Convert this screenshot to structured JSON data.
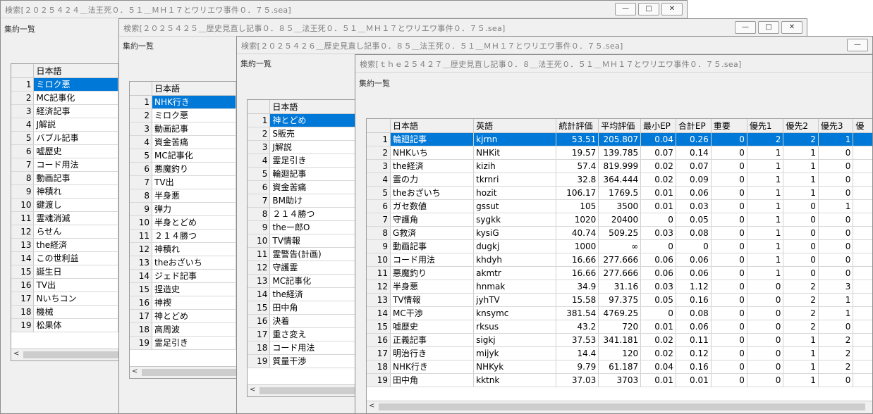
{
  "windows": [
    {
      "title": "検索[２０２５４２４＿法王死０．５１＿ＭＨ１７とワリエワ事件０．７５.sea]",
      "subtitle": "集約一覧",
      "header": "日本語",
      "rows": [
        "ミロク悪",
        "MC記事化",
        "経済記事",
        "J解説",
        "バブル記事",
        "嘘歴史",
        "コード用法",
        "動画記事",
        "神積れ",
        "鍵渡し",
        "霊魂消滅",
        "らせん",
        "the経済",
        "この世利益",
        "誕生日",
        "TV出",
        "Nいちコン",
        "機械",
        "松果体"
      ],
      "selected": 0
    },
    {
      "title": "検索[２０２５４２５＿歴史見直し記事０．８５＿法王死０．５１＿ＭＨ１７とワリエワ事件０．７５.sea]",
      "subtitle": "集約一覧",
      "header": "日本語",
      "rows": [
        "NHK行き",
        "ミロク悪",
        "動画記事",
        "資金苦痛",
        "MC記事化",
        "悪魔釣り",
        "TV出",
        "半身悪",
        "弾力",
        "半身とどめ",
        "２１４勝つ",
        "神積れ",
        "theおざいち",
        "ジェド記事",
        "捏造史",
        "神褉",
        "神とどめ",
        "高周波",
        "霊足引き"
      ],
      "selected": 0
    },
    {
      "title": "検索[２０２５４２６＿歴史見直し記事０．８５＿法王死０．５１＿ＭＨ１７とワリエワ事件０．７５.sea]",
      "subtitle": "集約一覧",
      "header": "日本語",
      "rows": [
        "神とどめ",
        "S販売",
        "J解説",
        "霊足引き",
        "輪廻記事",
        "資金苦痛",
        "BM助け",
        "２１４勝つ",
        "theー郎O",
        "TV情報",
        "霊警告(計画)",
        "守護霊",
        "MC記事化",
        "the経済",
        "田中角",
        "決着",
        "重さ変え",
        "コード用法",
        "質量干渉"
      ],
      "selected": 0
    }
  ],
  "main_window": {
    "title": "検索[ｔｈｅ２５４２７＿歴史見直し記事０．８＿法王死０．５１＿ＭＨ１７とワリエワ事件０．７５.sea]",
    "subtitle": "集約一覧",
    "columns": [
      "日本語",
      "英語",
      "統計評価",
      "平均評価",
      "最小EP",
      "合計EP",
      "重要",
      "優先1",
      "優先2",
      "優先3",
      "優"
    ],
    "rows": [
      [
        "輪廻記事",
        "kjrnn",
        "53.51",
        "205.807",
        "0.04",
        "0.26",
        "0",
        "2",
        "2",
        "1"
      ],
      [
        "NHKいち",
        "NHKit",
        "19.57",
        "139.785",
        "0.07",
        "0.14",
        "0",
        "1",
        "1",
        "0"
      ],
      [
        "the経済",
        "kizih",
        "57.4",
        "819.999",
        "0.02",
        "0.07",
        "0",
        "1",
        "1",
        "0"
      ],
      [
        "霊の力",
        "tkrnri",
        "32.8",
        "364.444",
        "0.02",
        "0.09",
        "0",
        "1",
        "1",
        "0"
      ],
      [
        "theおざいち",
        "hozit",
        "106.17",
        "1769.5",
        "0.01",
        "0.06",
        "0",
        "1",
        "1",
        "0"
      ],
      [
        "ガセ数値",
        "gssut",
        "105",
        "3500",
        "0.01",
        "0.03",
        "0",
        "1",
        "0",
        "1"
      ],
      [
        "守護角",
        "sygkk",
        "1020",
        "20400",
        "0",
        "0.05",
        "0",
        "1",
        "0",
        "0"
      ],
      [
        "G救済",
        "kysiG",
        "40.74",
        "509.25",
        "0.03",
        "0.08",
        "0",
        "1",
        "0",
        "0"
      ],
      [
        "動画記事",
        "dugkj",
        "1000",
        "∞",
        "0",
        "0",
        "0",
        "1",
        "0",
        "0"
      ],
      [
        "コード用法",
        "khdyh",
        "16.66",
        "277.666",
        "0.06",
        "0.06",
        "0",
        "1",
        "0",
        "0"
      ],
      [
        "悪魔釣り",
        "akmtr",
        "16.66",
        "277.666",
        "0.06",
        "0.06",
        "0",
        "1",
        "0",
        "0"
      ],
      [
        "半身悪",
        "hnmak",
        "34.9",
        "31.16",
        "0.03",
        "1.12",
        "0",
        "0",
        "2",
        "3"
      ],
      [
        "TV情報",
        "jyhTV",
        "15.58",
        "97.375",
        "0.05",
        "0.16",
        "0",
        "0",
        "2",
        "1"
      ],
      [
        "MC干渉",
        "knsymc",
        "381.54",
        "4769.25",
        "0",
        "0.08",
        "0",
        "0",
        "2",
        "1"
      ],
      [
        "嘘歴史",
        "rksus",
        "43.2",
        "720",
        "0.01",
        "0.06",
        "0",
        "0",
        "2",
        "0"
      ],
      [
        "正義記事",
        "sigkj",
        "37.53",
        "341.181",
        "0.02",
        "0.11",
        "0",
        "0",
        "1",
        "2"
      ],
      [
        "明治行き",
        "mijyk",
        "14.4",
        "120",
        "0.02",
        "0.12",
        "0",
        "0",
        "1",
        "2"
      ],
      [
        "NHK行き",
        "NHKyk",
        "9.79",
        "61.187",
        "0.04",
        "0.16",
        "0",
        "0",
        "1",
        "2"
      ],
      [
        "田中角",
        "kktnk",
        "37.03",
        "3703",
        "0.01",
        "0.01",
        "0",
        "0",
        "1",
        "0"
      ]
    ],
    "selected": 0
  },
  "controls": {
    "minimize_glyph": "—",
    "maximize_glyph": "□",
    "close_glyph": "✕",
    "scroll_left_glyph": "<"
  },
  "colors": {
    "selection": "#0078d7",
    "window_bg": "#f0f0f0"
  }
}
